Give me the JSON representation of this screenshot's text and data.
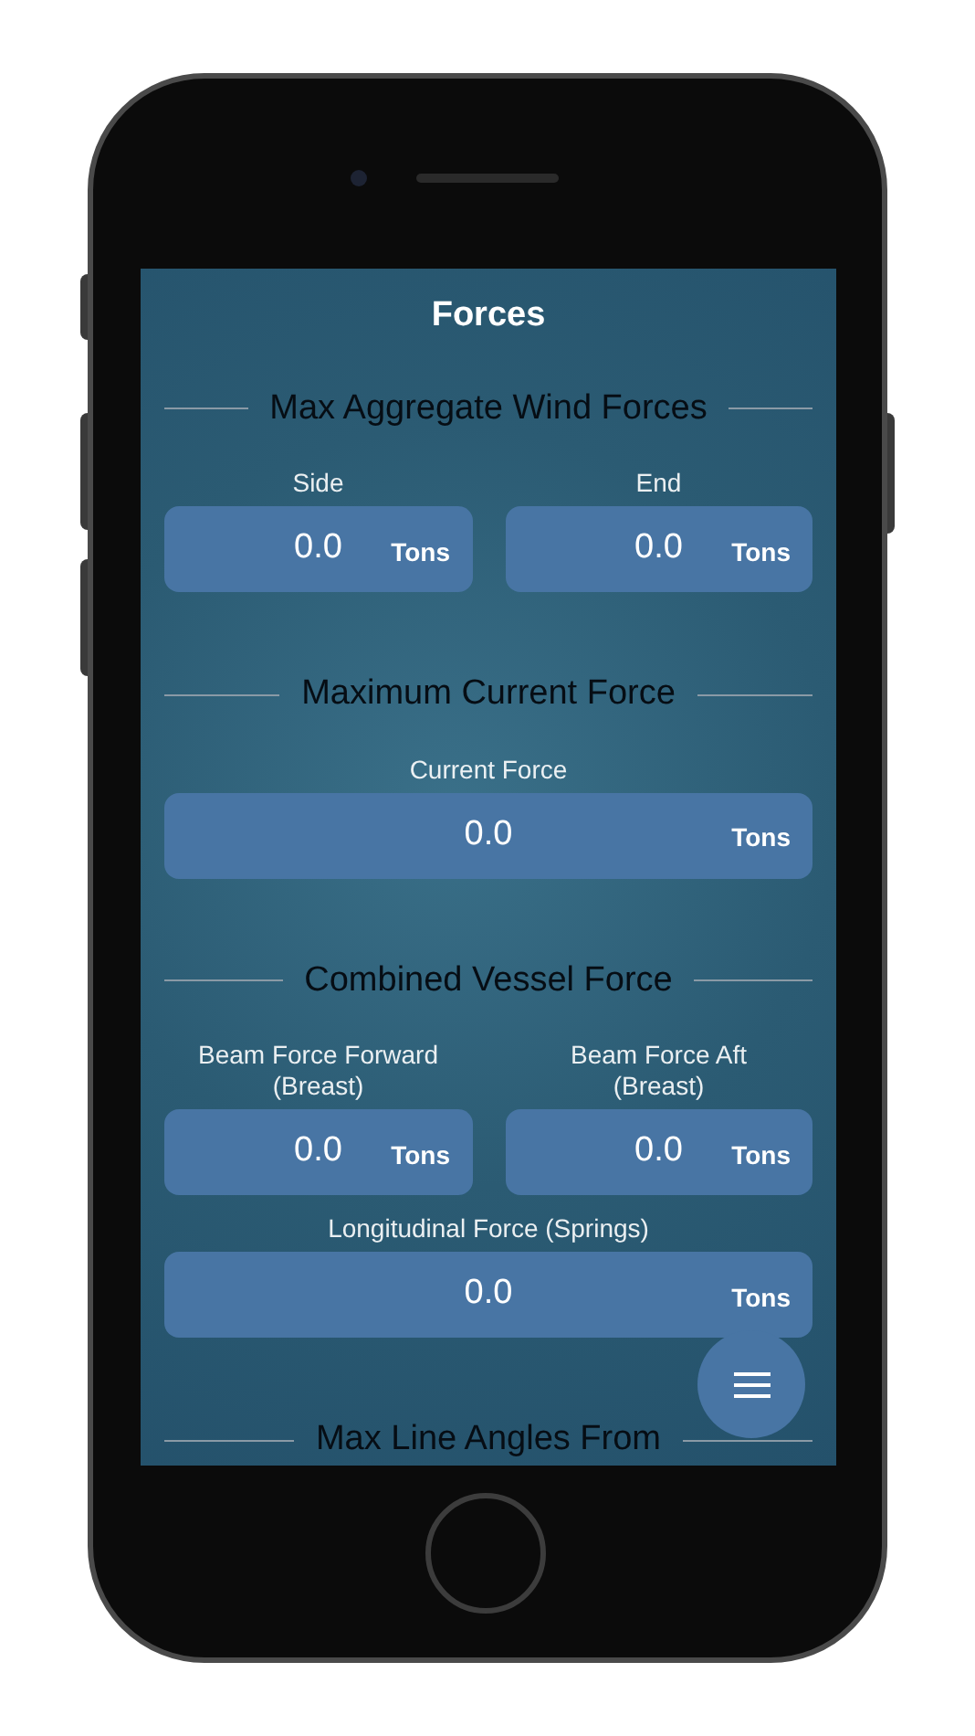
{
  "screen": {
    "title": "Forces",
    "sections": [
      {
        "title": "Max Aggregate Wind Forces",
        "fields": [
          {
            "label": "Side",
            "value": "0.0",
            "unit": "Tons"
          },
          {
            "label": "End",
            "value": "0.0",
            "unit": "Tons"
          }
        ]
      },
      {
        "title": "Maximum Current Force",
        "fields": [
          {
            "label": "Current Force",
            "value": "0.0",
            "unit": "Tons"
          }
        ]
      },
      {
        "title": "Combined Vessel Force",
        "fields": [
          {
            "label": "Beam Force Forward (Breast)",
            "value": "0.0",
            "unit": "Tons"
          },
          {
            "label": "Beam Force Aft (Breast)",
            "value": "0.0",
            "unit": "Tons"
          },
          {
            "label": "Longitudinal Force (Springs)",
            "value": "0.0",
            "unit": "Tons"
          }
        ]
      },
      {
        "title": "Max Line Angles From"
      }
    ]
  }
}
